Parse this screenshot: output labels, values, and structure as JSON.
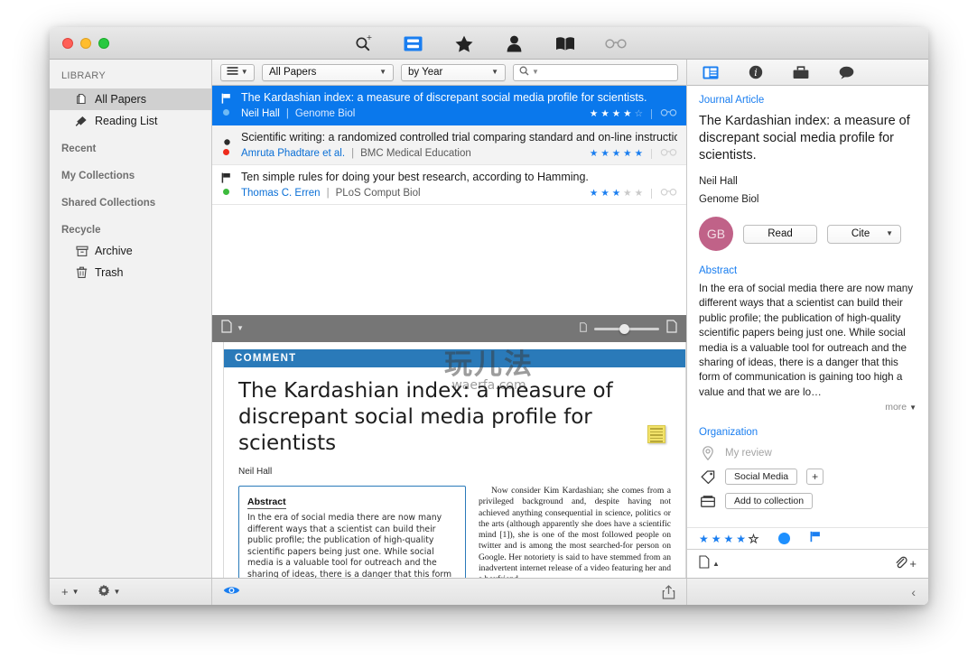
{
  "window": {
    "traffic_lights": [
      "close",
      "minimize",
      "zoom"
    ],
    "toolbar_icons": [
      "search-plus-icon",
      "split-view-icon",
      "star-icon",
      "person-icon",
      "book-icon",
      "glasses-icon"
    ]
  },
  "sidebar": {
    "header": "LIBRARY",
    "items": [
      {
        "label": "All Papers",
        "icon": "papers-icon",
        "selected": true
      },
      {
        "label": "Reading List",
        "icon": "reading-list-icon",
        "selected": false
      }
    ],
    "groups": [
      {
        "label": "Recent",
        "items": []
      },
      {
        "label": "My Collections",
        "items": []
      },
      {
        "label": "Shared Collections",
        "items": []
      },
      {
        "label": "Recycle",
        "items": [
          {
            "label": "Archive",
            "icon": "archive-icon"
          },
          {
            "label": "Trash",
            "icon": "trash-icon"
          }
        ]
      }
    ]
  },
  "filter_bar": {
    "view_menu_icon": "list-lines-icon",
    "collection_filter": "All Papers",
    "sort_filter": "by Year",
    "search_placeholder": "",
    "search_value": "",
    "search_icon": "magnifier-icon"
  },
  "paper_list": {
    "rows": [
      {
        "title": "The Kardashian index: a measure of discrepant social media profile for scientists.",
        "authors": "Neil Hall",
        "journal": "Genome Biol",
        "rating": 4,
        "max_rating": 5,
        "flag": true,
        "dot_color": "#4aa3f0",
        "read_icon": "glasses-icon",
        "selected": true
      },
      {
        "title": "Scientific writing: a randomized controlled trial comparing standard and on-line instruction",
        "authors": "Amruta Phadtare et al.",
        "journal": "BMC Medical Education",
        "rating": 5,
        "max_rating": 5,
        "flag": false,
        "dot_color": "#ee2b1c",
        "read_icon": "glasses-icon",
        "selected": false
      },
      {
        "title": "Ten simple rules for doing your best research, according to Hamming.",
        "authors": "Thomas C. Erren",
        "journal": "PLoS Comput Biol",
        "rating": 3,
        "max_rating": 5,
        "flag": true,
        "dot_color": "#3dbb3d",
        "read_icon": "glasses-icon",
        "selected": false
      }
    ]
  },
  "pdf_toolbar": {
    "page_icon": "page-icon",
    "zoom_small_icon": "page-small-icon",
    "zoom_large_icon": "page-large-icon",
    "zoom_value": 38
  },
  "pdf_page": {
    "section_label": "COMMENT",
    "title": "The Kardashian index: a measure of discrepant social media profile for scientists",
    "author": "Neil Hall",
    "abstract_heading": "Abstract",
    "abstract_text": "In the era of social media there are now many different ways that a scientist can build their public profile; the publication of high-quality scientific papers being just one. While social media is a valuable tool for outreach and the sharing of ideas, there is a danger that this form of communication is gaining too high a value and that",
    "right_column_text": "Now consider Kim Kardashian; she comes from a privileged background and, despite having not achieved anything consequential in science, politics or the arts (although apparently she does have a scientific mind [1]), she is one of the most followed people on twitter and is among the most searched-for person on Google. Her notoriety is said to have stemmed from an inadvertent internet release of a video featuring her and a boyfriend",
    "sticky_note_icon": "sticky-note-icon"
  },
  "watermark": {
    "logo_text": "玩儿法",
    "domain": "waerfa.com"
  },
  "right_panel": {
    "tabs": [
      {
        "icon": "info-panel-icon",
        "active": true
      },
      {
        "icon": "info-circle-icon",
        "active": false
      },
      {
        "icon": "briefcase-icon",
        "active": false
      },
      {
        "icon": "comment-icon",
        "active": false
      }
    ],
    "kind": "Journal Article",
    "title": "The Kardashian index: a measure of discrepant social media profile for scientists.",
    "author": "Neil Hall",
    "journal": "Genome Biol",
    "avatar_initials": "GB",
    "avatar_color": "#c06288",
    "read_button": "Read",
    "cite_button": "Cite",
    "abstract_heading": "Abstract",
    "abstract_text": "In the era of social media there are now many different ways that a scientist can build their public profile; the publication of high-quality scientific papers being just one. While social media is a valuable tool for outreach and the sharing of ideas, there is a danger that this form of communication is gaining too high a value and that we are lo…",
    "more_label": "more",
    "organization_heading": "Organization",
    "my_review_placeholder": "My review",
    "review_icon": "location-pin-icon",
    "tag_icon": "tag-icon",
    "tags": [
      "Social Media"
    ],
    "add_tag_label": "+",
    "collection_icon": "folder-icon",
    "add_collection_label": "Add to collection",
    "rating": 4,
    "max_rating": 5,
    "status_dot_color": "#1e90ff",
    "flag_color": "#1a7ef0",
    "attachment_icon": "paperclip-icon",
    "attachment_add_label": "+",
    "file_icon": "file-icon"
  },
  "bottom_bar": {
    "add_label": "+",
    "gear_icon": "gear-icon",
    "preview_icon": "eye-icon",
    "share_icon": "share-icon",
    "collapse_icon": "chevron-left-icon"
  },
  "colors": {
    "selection_blue": "#0a78ec",
    "accent_blue": "#1a7ef0",
    "link_blue": "#0a6fd6",
    "pdf_banner": "#2a7ab9"
  }
}
